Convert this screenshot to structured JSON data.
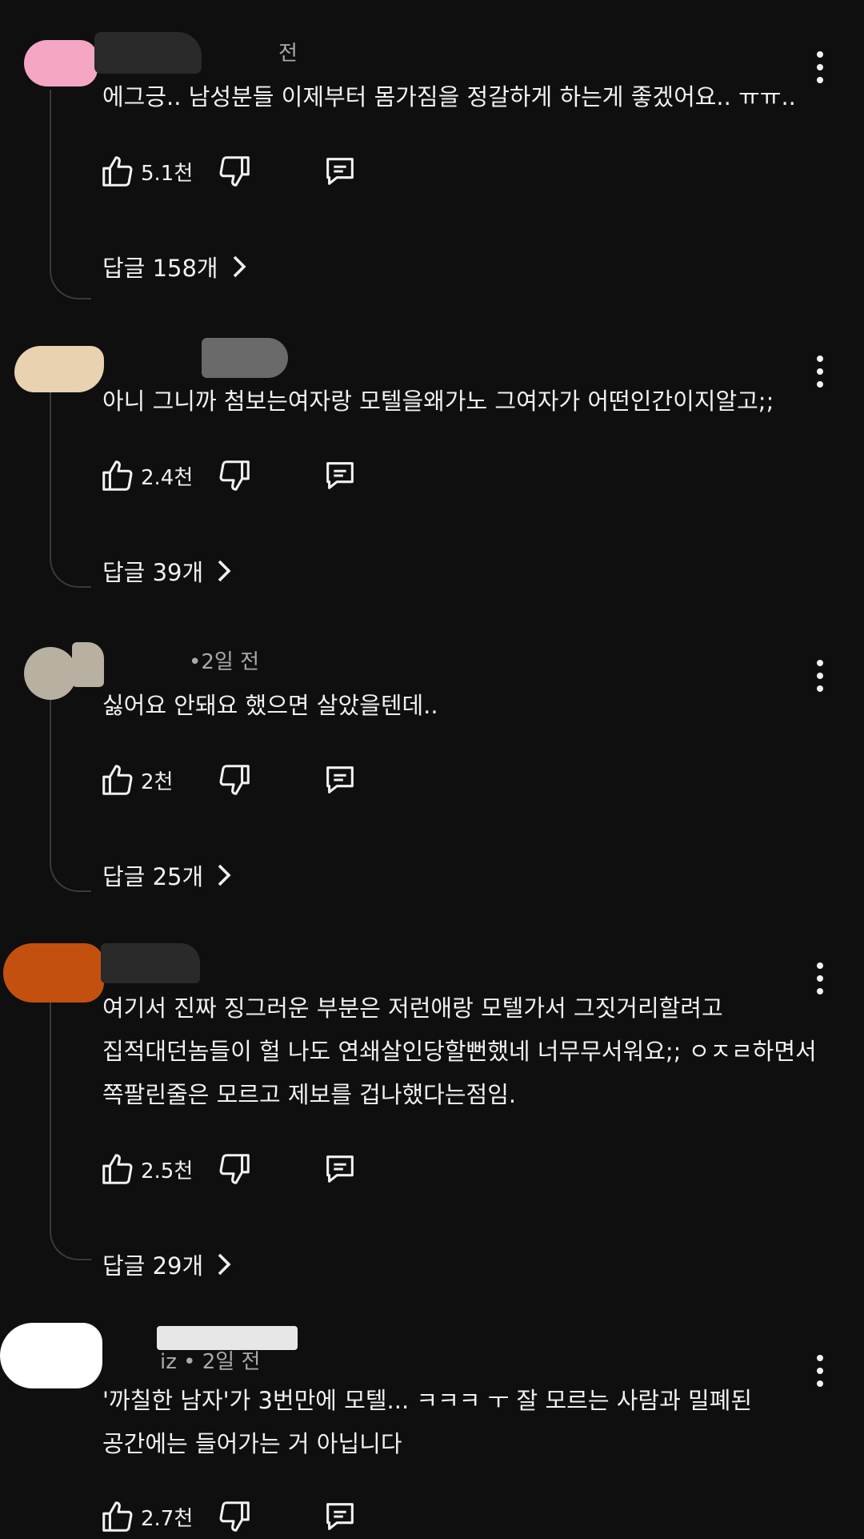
{
  "comments": [
    {
      "meta": "전",
      "lines": [
        "에그긍.. 남성분들 이제부터 몸가짐을 정갈하게 하는게 좋겠어요.. ㅠㅠ.."
      ],
      "likes": "5.1천",
      "replies": "답글 158개",
      "avatar_color": "#f4a6c4"
    },
    {
      "meta": "",
      "lines": [
        "아니 그니까 첨보는여자랑 모텔을왜가노 그여자가 어떤인간이지알고;;"
      ],
      "likes": "2.4천",
      "replies": "답글 39개",
      "avatar_color": "#e8d2b0"
    },
    {
      "meta": "•2일 전",
      "lines": [
        "싫어요 안돼요 했으면 살았을텐데.."
      ],
      "likes": "2천",
      "replies": "답글 25개",
      "avatar_color": "#b8b0a0"
    },
    {
      "meta": "",
      "lines": [
        "여기서 진짜 징그러운 부분은 저런애랑 모텔가서 그짓거리할려고",
        "집적대던놈들이 헐 나도 연쇄살인당할뻔했네 너무무서워요;; ㅇㅈㄹ하면서",
        "쪽팔린줄은 모르고 제보를 겁나했다는점임."
      ],
      "likes": "2.5천",
      "replies": "답글 29개",
      "avatar_color": "#c4500f"
    },
    {
      "meta": "iz • 2일 전",
      "lines": [
        "'까칠한 남자'가 3번만에 모텔... ㅋㅋㅋ ㅜ 잘 모르는 사람과 밀폐된",
        "공간에는 들어가는 거 아닙니다"
      ],
      "likes": "2.7천",
      "replies": "",
      "avatar_color": "#ffffff"
    }
  ],
  "icons": {
    "like": "thumbs-up-icon",
    "dislike": "thumbs-down-icon",
    "reply": "comment-icon",
    "more": "more-vert-icon",
    "chevron": "chevron-right-icon"
  }
}
